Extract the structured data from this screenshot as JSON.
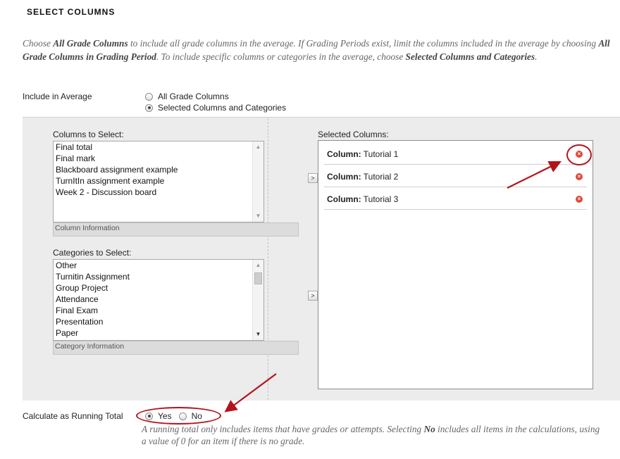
{
  "section_title": "SELECT COLUMNS",
  "instructions": {
    "p1": "Choose ",
    "b1": "All Grade Columns",
    "p2": " to include all grade columns in the average. If Grading Periods exist, limit the columns included in the average by choosing ",
    "b2": "All Grade Columns in Grading Period",
    "p3": ". To include specific columns or categories in the average, choose ",
    "b3": "Selected Columns and Categories",
    "p4": "."
  },
  "include_in_average": {
    "label": "Include in Average",
    "options": [
      {
        "label": "All Grade Columns",
        "checked": false
      },
      {
        "label": "Selected Columns and Categories",
        "checked": true
      }
    ]
  },
  "columns_to_select": {
    "label": "Columns to Select:",
    "items": [
      "Final total",
      "Final mark",
      "Blackboard assignment example",
      "TurnItIn assignment example",
      "Week 2 - Discussion board"
    ],
    "info": "Column Information"
  },
  "categories_to_select": {
    "label": "Categories to Select:",
    "items": [
      "Other",
      "Turnitin Assignment",
      "Group Project",
      "Attendance",
      "Final Exam",
      "Presentation",
      "Paper"
    ],
    "info": "Category Information"
  },
  "move_button_glyph": ">",
  "selected_columns": {
    "label": "Selected Columns:",
    "items": [
      {
        "prefix": "Column:",
        "name": "Tutorial 1"
      },
      {
        "prefix": "Column:",
        "name": "Tutorial 2"
      },
      {
        "prefix": "Column:",
        "name": "Tutorial 3"
      }
    ],
    "remove_glyph": "×"
  },
  "running_total": {
    "label": "Calculate as Running Total",
    "yes_label": "Yes",
    "no_label": "No",
    "yes_checked": true,
    "note_p1": "A running total only includes items that have grades or attempts. Selecting ",
    "note_b1": "No",
    "note_p2": " includes all items in the calculations, using a value of 0 for an item if there is no grade."
  },
  "colors": {
    "annotation_red": "#b3141c",
    "remove_red": "#e04a3a",
    "panel_gray": "#ececec"
  }
}
